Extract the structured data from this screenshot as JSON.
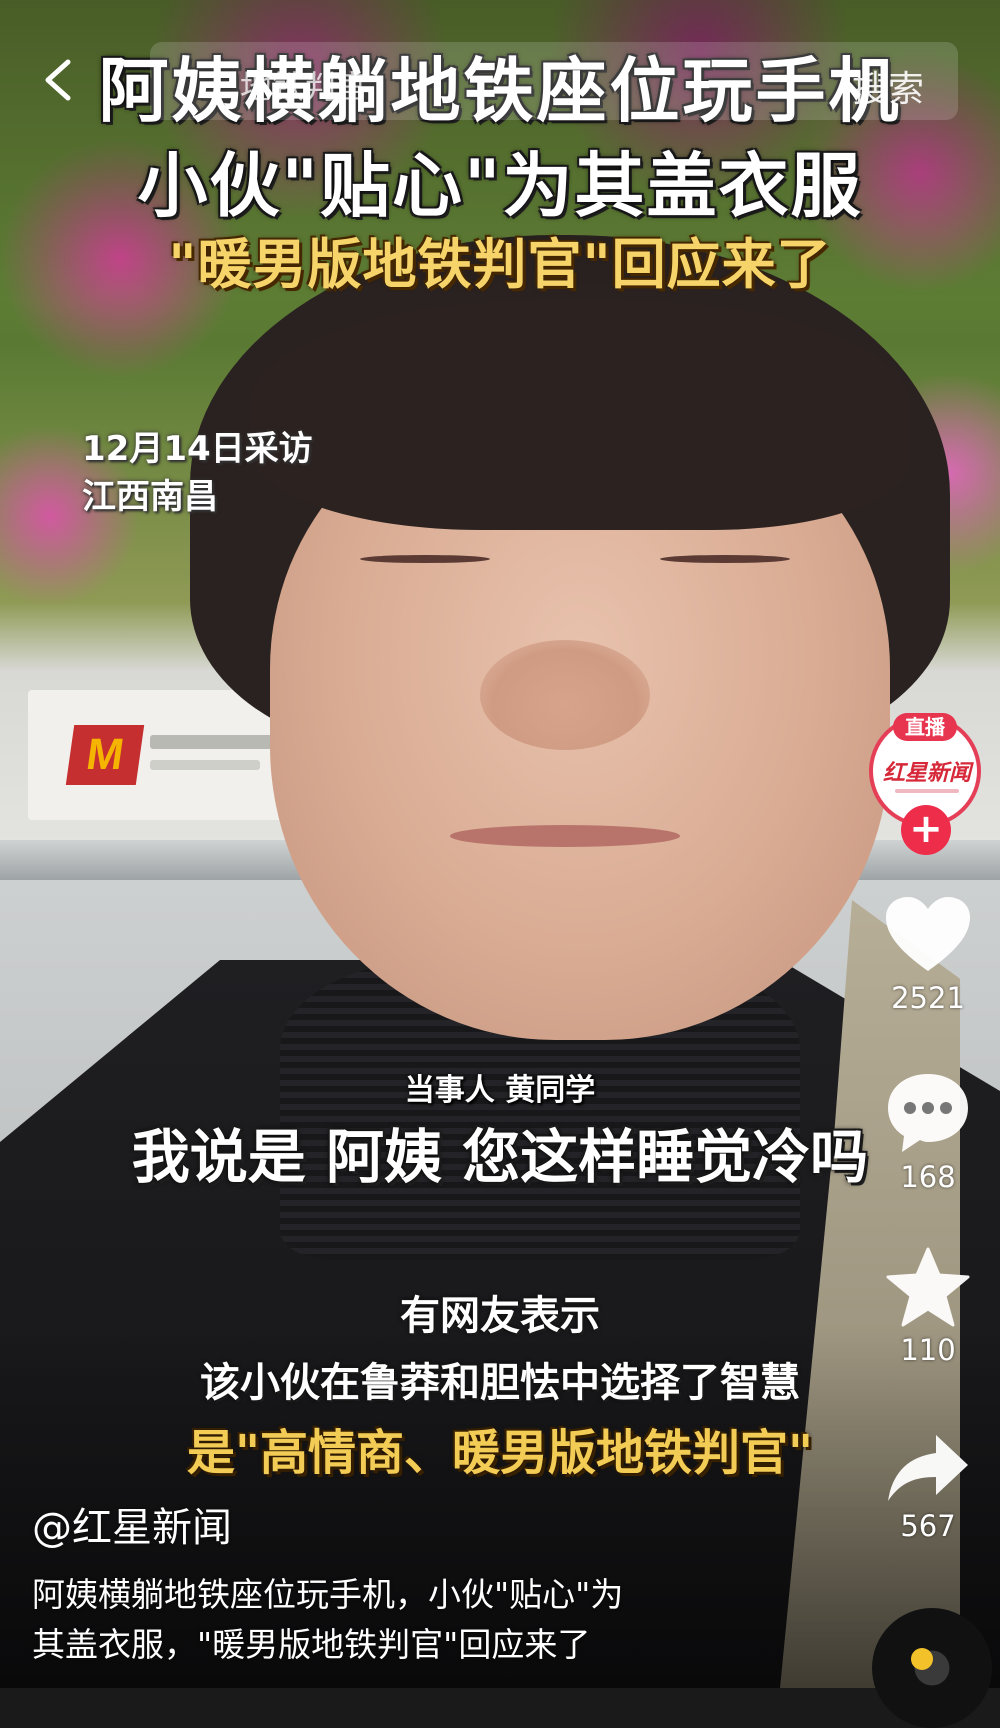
{
  "header": {
    "back_icon": "chevron-left-icon",
    "search_placeholder": "地铁判官",
    "search_button": "搜索"
  },
  "video": {
    "title_line1": "阿姨横躺地铁座位玩手机",
    "title_line2": "小伙\"贴心\"为其盖衣服",
    "title_line3": "\"暖男版地铁判官\"回应来了",
    "meta_date": "12月14日采访",
    "meta_location": "江西南昌",
    "speaker": "当事人  黄同学",
    "quote": "我说是 阿姨 您这样睡觉冷吗",
    "note_line1": "有网友表示",
    "note_line2": "该小伙在鲁莽和胆怯中选择了智慧",
    "note_line3": "是\"高情商、暖男版地铁判官\""
  },
  "sidebar": {
    "avatar_live_label": "直播",
    "avatar_name": "红星新闻",
    "follow_label": "+",
    "like_count": "2521",
    "comment_count": "168",
    "favorite_count": "110",
    "share_count": "567"
  },
  "post": {
    "author": "@红星新闻",
    "description_line1": "阿姨横躺地铁座位玩手机，小伙\"贴心\"为",
    "description_line2": "其盖衣服，\"暖男版地铁判官\"回应来了"
  },
  "colors": {
    "accent_red": "#ee2d4a",
    "caption_yellow": "#f6d46a"
  }
}
